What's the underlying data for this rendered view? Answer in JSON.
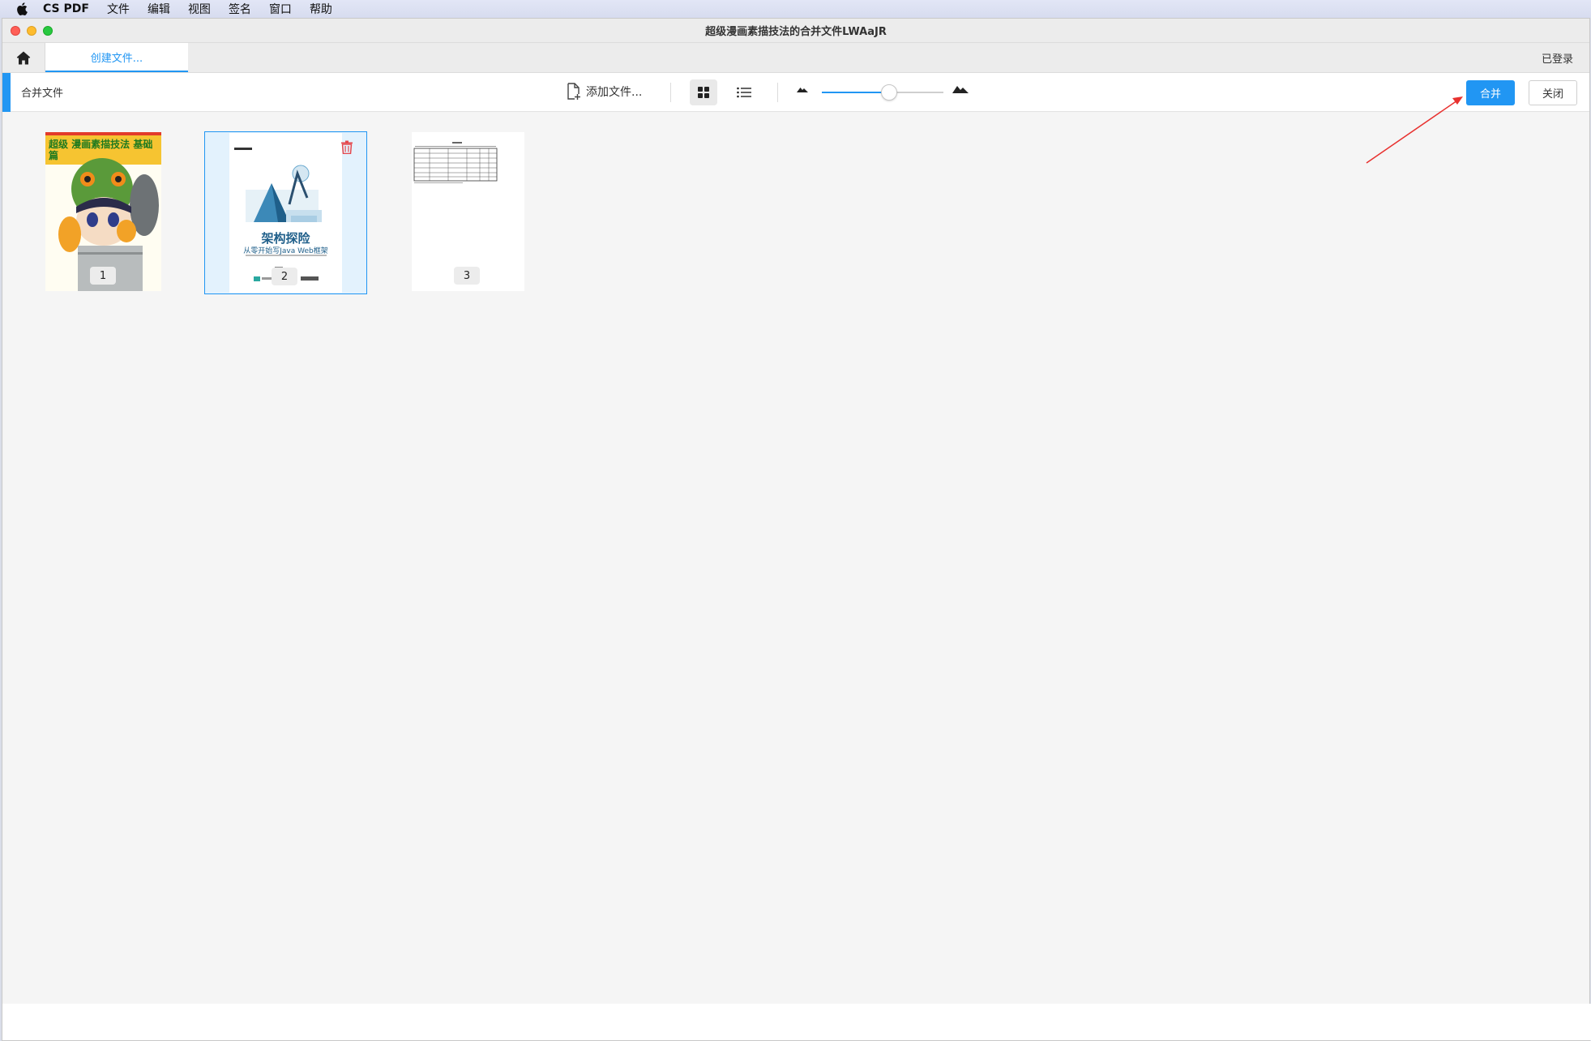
{
  "menubar": {
    "app_name": "CS PDF",
    "items": [
      "文件",
      "编辑",
      "视图",
      "签名",
      "窗口",
      "帮助"
    ]
  },
  "window": {
    "title": "超级漫画素描技法的合并文件LWAaJR"
  },
  "tabbar": {
    "active_tab": "创建文件...",
    "login_status": "已登录"
  },
  "toolbar": {
    "section_label": "合并文件",
    "add_file_label": "添加文件...",
    "view_mode": "grid",
    "zoom_level": 0.55,
    "merge_label": "合并",
    "close_label": "关闭"
  },
  "pages": [
    {
      "number": "1",
      "title": "超级 漫画素描技法 基础篇",
      "selected": false
    },
    {
      "number": "2",
      "title": "架构探险",
      "subtitle": "从零开始写Java Web框架",
      "selected": true
    },
    {
      "number": "3",
      "title": "",
      "selected": false
    }
  ],
  "colors": {
    "accent": "#2196f3",
    "annotation_arrow": "#e8312f",
    "trash": "#e5484d"
  }
}
